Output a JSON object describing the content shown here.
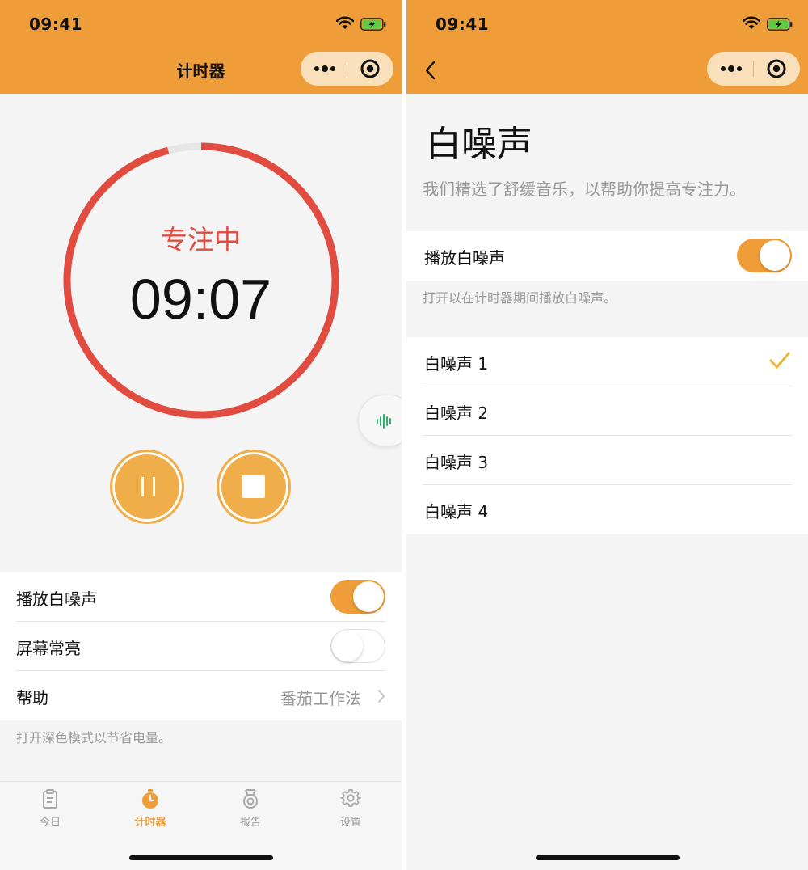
{
  "status_bar": {
    "time": "09:41"
  },
  "left_screen": {
    "nav_title": "计时器",
    "timer": {
      "status": "专注中",
      "time": "09:07",
      "progress": 0.96
    },
    "settings": [
      {
        "label": "播放白噪声",
        "type": "switch",
        "on": true
      },
      {
        "label": "屏幕常亮",
        "type": "switch",
        "on": false
      },
      {
        "label": "帮助",
        "type": "link",
        "value": "番茄工作法"
      }
    ],
    "footnote": "打开深色模式以节省电量。",
    "tabs": [
      {
        "label": "今日",
        "icon": "clipboard-icon",
        "active": false
      },
      {
        "label": "计时器",
        "icon": "stopwatch-icon",
        "active": true
      },
      {
        "label": "报告",
        "icon": "medal-icon",
        "active": false
      },
      {
        "label": "设置",
        "icon": "gear-icon",
        "active": false
      }
    ]
  },
  "right_screen": {
    "heading": "白噪声",
    "subtitle": "我们精选了舒缓音乐，以帮助你提高专注力。",
    "play_toggle": {
      "label": "播放白噪声",
      "on": true
    },
    "play_footnote": "打开以在计时器期间播放白噪声。",
    "sounds": [
      {
        "label": "白噪声 1",
        "selected": true
      },
      {
        "label": "白噪声 2",
        "selected": false
      },
      {
        "label": "白噪声 3",
        "selected": false
      },
      {
        "label": "白噪声 4",
        "selected": false
      }
    ]
  },
  "colors": {
    "accent": "#ee9d38",
    "timer_ring": "#e24b3f",
    "ring_track": "#e6e6e6",
    "button": "#f0ae4b",
    "check": "#f0b53c",
    "audio_wave": "#27b36a"
  }
}
